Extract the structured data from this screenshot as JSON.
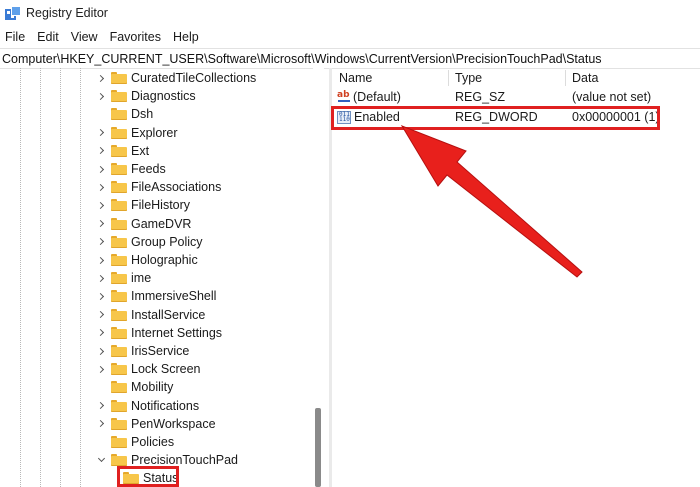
{
  "window": {
    "title": "Registry Editor"
  },
  "menu": [
    "File",
    "Edit",
    "View",
    "Favorites",
    "Help"
  ],
  "address": "Computer\\HKEY_CURRENT_USER\\Software\\Microsoft\\Windows\\CurrentVersion\\PrecisionTouchPad\\Status",
  "tree": {
    "items": [
      {
        "label": "CuratedTileCollections",
        "expander": "collapsed"
      },
      {
        "label": "Diagnostics",
        "expander": "collapsed"
      },
      {
        "label": "Dsh",
        "expander": "none"
      },
      {
        "label": "Explorer",
        "expander": "collapsed"
      },
      {
        "label": "Ext",
        "expander": "collapsed"
      },
      {
        "label": "Feeds",
        "expander": "collapsed"
      },
      {
        "label": "FileAssociations",
        "expander": "collapsed"
      },
      {
        "label": "FileHistory",
        "expander": "collapsed"
      },
      {
        "label": "GameDVR",
        "expander": "collapsed"
      },
      {
        "label": "Group Policy",
        "expander": "collapsed"
      },
      {
        "label": "Holographic",
        "expander": "collapsed"
      },
      {
        "label": "ime",
        "expander": "collapsed"
      },
      {
        "label": "ImmersiveShell",
        "expander": "collapsed"
      },
      {
        "label": "InstallService",
        "expander": "collapsed"
      },
      {
        "label": "Internet Settings",
        "expander": "collapsed"
      },
      {
        "label": "IrisService",
        "expander": "collapsed"
      },
      {
        "label": "Lock Screen",
        "expander": "collapsed"
      },
      {
        "label": "Mobility",
        "expander": "none"
      },
      {
        "label": "Notifications",
        "expander": "collapsed"
      },
      {
        "label": "PenWorkspace",
        "expander": "collapsed"
      },
      {
        "label": "Policies",
        "expander": "none"
      },
      {
        "label": "PrecisionTouchPad",
        "expander": "expanded"
      },
      {
        "label": "Status",
        "expander": "none",
        "child": true,
        "highlighted": true
      }
    ]
  },
  "list": {
    "columns": [
      "Name",
      "Type",
      "Data"
    ],
    "rows": [
      {
        "icon": "string-value-icon",
        "name": "(Default)",
        "type": "REG_SZ",
        "data": "(value not set)"
      },
      {
        "icon": "dword-value-icon",
        "name": "Enabled",
        "type": "REG_DWORD",
        "data": "0x00000001 (1)",
        "highlighted": true
      }
    ]
  },
  "colors": {
    "highlight": "#e02020",
    "folder": "#f7c64a"
  }
}
